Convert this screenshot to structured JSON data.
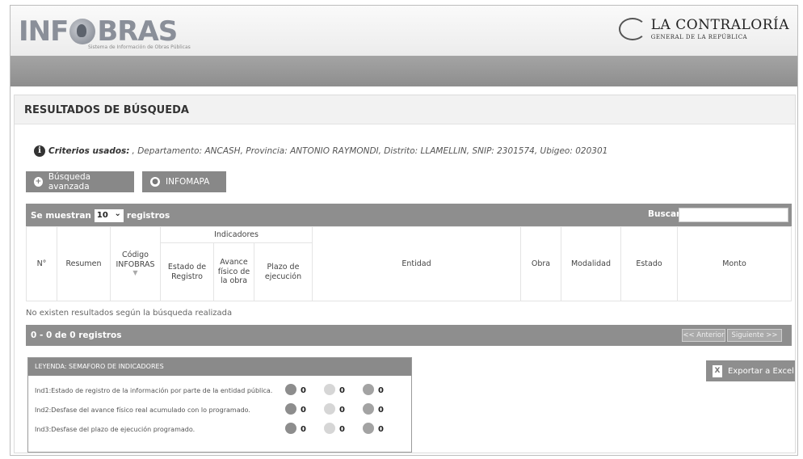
{
  "header": {
    "logo_text_left": "INF",
    "logo_text_right": "BRAS",
    "logo_subtitle": "Sistema de Información de Obras Públicas",
    "org_title": "LA CONTRALORÍA",
    "org_subtitle": "GENERAL DE LA REPÚBLICA"
  },
  "panel": {
    "title": "RESULTADOS DE BÚSQUEDA",
    "criteria_label": "Criterios usados:",
    "criteria_text": ", Departamento: ANCASH, Provincia: ANTONIO RAYMONDI, Distrito: LLAMELLIN, SNIP: 2301574, Ubigeo: 020301"
  },
  "buttons": {
    "advanced_search": "Búsqueda avanzada",
    "infomapa": "INFOMAPA",
    "export_excel": "Exportar a Excel"
  },
  "table_controls": {
    "show_prefix": "Se muestran",
    "page_size": "10",
    "show_suffix": "registros",
    "search_label": "Buscar:",
    "search_value": ""
  },
  "table": {
    "group_header": "Indicadores",
    "columns": {
      "num": "N°",
      "resumen": "Resumen",
      "codigo": "Código INFOBRAS",
      "estado_registro": "Estado de Registro",
      "avance": "Avance físico de la obra",
      "plazo": "Plazo de ejecución",
      "entidad": "Entidad",
      "obra": "Obra",
      "modalidad": "Modalidad",
      "estado": "Estado",
      "monto": "Monto"
    },
    "empty_message": "No existen resultados según la búsqueda realizada",
    "rows": []
  },
  "pagination": {
    "info": "0 - 0 de 0 registros",
    "prev": "<< Anterior",
    "next": "Siguiente >>"
  },
  "legend": {
    "title": "LEYENDA: SEMAFORO DE INDICADORES",
    "rows": [
      {
        "label": "Ind1:Estado de registro de la información por parte de la entidad pública.",
        "counts": [
          "0",
          "0",
          "0"
        ]
      },
      {
        "label": "Ind2:Desfase del avance físico real acumulado con lo programado.",
        "counts": [
          "0",
          "0",
          "0"
        ]
      },
      {
        "label": "Ind3:Desfase del plazo de ejecución programado.",
        "counts": [
          "0",
          "0",
          "0"
        ]
      }
    ]
  }
}
